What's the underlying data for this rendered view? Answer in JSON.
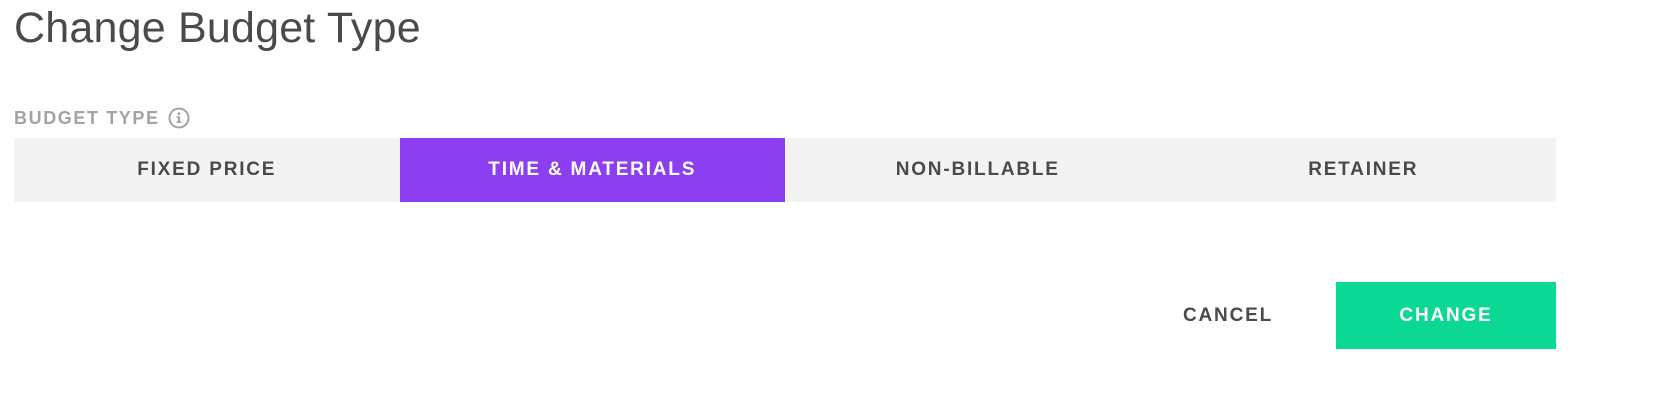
{
  "dialog": {
    "title": "Change Budget Type"
  },
  "budget_type": {
    "label": "BUDGET TYPE",
    "info_icon": "info-circle-icon",
    "options": [
      {
        "label": "FIXED PRICE",
        "selected": false
      },
      {
        "label": "TIME & MATERIALS",
        "selected": true
      },
      {
        "label": "NON-BILLABLE",
        "selected": false
      },
      {
        "label": "RETAINER",
        "selected": false
      }
    ]
  },
  "actions": {
    "cancel_label": "CANCEL",
    "change_label": "CHANGE"
  },
  "colors": {
    "selected_segment": "#8b3ff0",
    "primary_button": "#0bd894",
    "segment_background": "#f3f3f3",
    "text": "#4a4a4a",
    "muted_label": "#a3a3a3"
  }
}
